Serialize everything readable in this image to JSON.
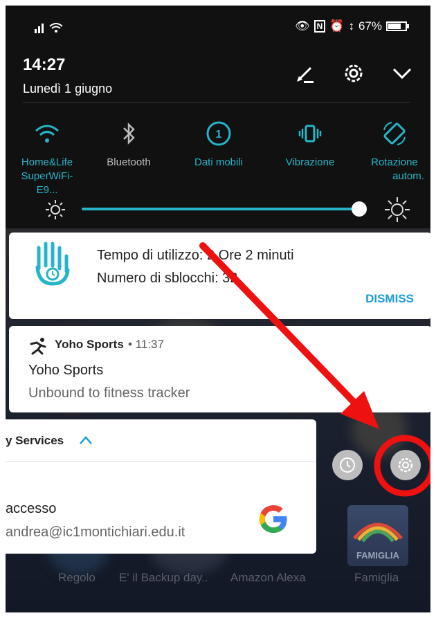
{
  "status_bar": {
    "time": "14:27",
    "battery": "67%"
  },
  "header": {
    "date": "Lunedì 1 giugno"
  },
  "quick_settings": [
    {
      "label_line1": "Home&Life",
      "label_line2": "SuperWiFi-E9...",
      "icon": "wifi-icon",
      "active": true
    },
    {
      "label_line1": "Bluetooth",
      "label_line2": "",
      "icon": "bluetooth-icon",
      "active": false
    },
    {
      "label_line1": "Dati mobili",
      "label_line2": "",
      "icon": "mobile-data-icon",
      "active": true
    },
    {
      "label_line1": "Vibrazione",
      "label_line2": "",
      "icon": "vibration-icon",
      "active": true
    },
    {
      "label_line1": "Rotazione",
      "label_line2": "autom.",
      "icon": "rotation-icon",
      "active": true
    }
  ],
  "brightness": {
    "level": 0.97
  },
  "notifications": {
    "usage": {
      "line1": "Tempo di utilizzo: 2 Ore 2 minuti",
      "line2": "Numero di sblocchi: 32",
      "action": "DISMISS"
    },
    "yoho": {
      "app": "Yoho Sports",
      "time": "• 11:37",
      "title": "Yoho Sports",
      "body": "Unbound to fitness tracker"
    },
    "google": {
      "app_partial": "y Services",
      "title_partial": "accesso",
      "email_partial": "andrea@ic1montichiari.edu.it"
    }
  },
  "home_labels": [
    "Regolo",
    "E' il Backup day..",
    "Amazon Alexa",
    "Famiglia"
  ],
  "famiglia_tile_text": "FAMIGLIA",
  "colors": {
    "accent": "#26b5c8",
    "arrow": "#ee1111",
    "dismiss": "#1e9bd7",
    "google_blue": "#4285f4",
    "google_red": "#ea4335",
    "google_yellow": "#fbbc05",
    "google_green": "#34a853"
  }
}
